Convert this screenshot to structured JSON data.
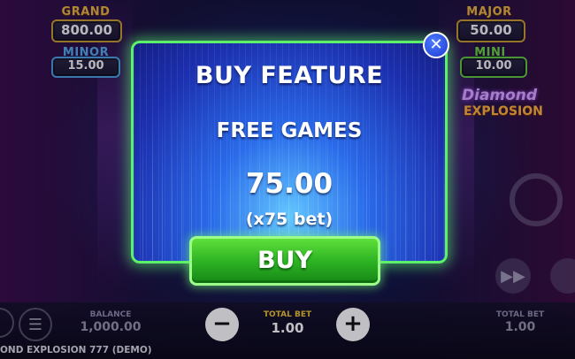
{
  "jackpots": {
    "grand": {
      "label": "GRAND",
      "value": "800.00"
    },
    "minor": {
      "label": "MINOR",
      "value": "15.00"
    },
    "major": {
      "label": "MAJOR",
      "value": "50.00"
    },
    "mini": {
      "label": "MINI",
      "value": "10.00"
    }
  },
  "logo": {
    "line1": "Diamond",
    "line2": "EXPLOSION"
  },
  "modal": {
    "title": "BUY FEATURE",
    "feature_name": "FREE GAMES",
    "price": "75.00",
    "multiplier": "(x75 bet)",
    "buy_label": "BUY",
    "close_icon": "close-icon"
  },
  "bottom_bar": {
    "balance_label": "BALANCE",
    "balance_value": "1,000.00",
    "total_bet_label": "TOTAL BET",
    "total_bet_value": "1.00",
    "total_bet_label_right": "TOTAL BET",
    "total_bet_value_right": "1.00",
    "minus_icon": "minus-icon",
    "plus_icon": "plus-icon",
    "menu_icon": "menu-icon"
  },
  "game_title": "OND EXPLOSION 777 (DEMO)",
  "colors": {
    "modal_border": "#5df06a",
    "buy_button": "#2eb424",
    "close_button": "#1d3ad0",
    "total_bet_label": "#f0c530"
  }
}
